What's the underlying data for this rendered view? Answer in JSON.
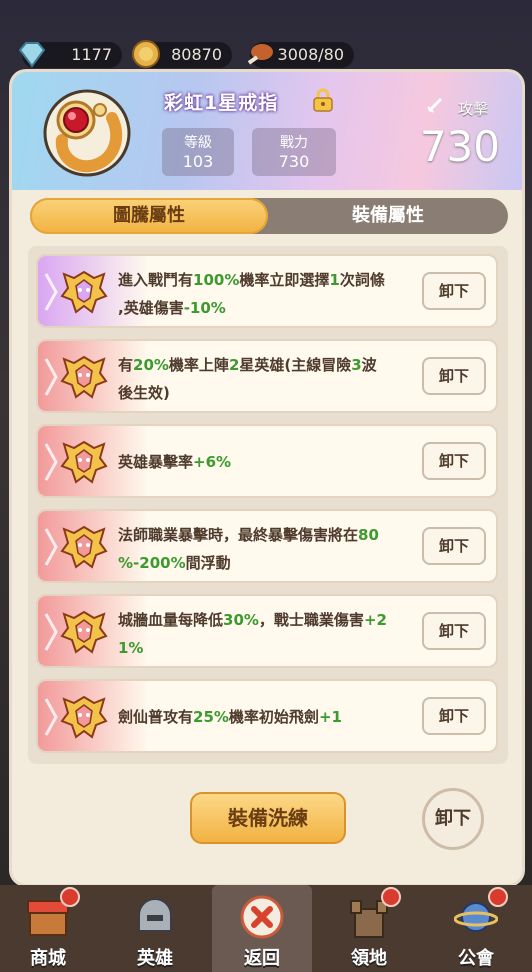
{
  "resources": [
    {
      "icon": "diamond-icon",
      "value": "1177"
    },
    {
      "icon": "coin-icon",
      "value": "80870"
    },
    {
      "icon": "meat-icon",
      "value": "3008/80"
    }
  ],
  "item": {
    "name": "彩虹1星戒指",
    "level_label": "等級",
    "level_value": "103",
    "power_label": "戰力",
    "power_value": "730",
    "attack_label": "攻擊",
    "attack_value": "730"
  },
  "tabs": [
    {
      "label": "圖騰屬性",
      "active": true
    },
    {
      "label": "裝備屬性",
      "active": false
    }
  ],
  "attributes": [
    {
      "rarity_color": "#d9a6f2",
      "segments": [
        {
          "t": "進入戰鬥有"
        },
        {
          "t": "100%",
          "h": 1
        },
        {
          "t": "機率立即選擇"
        },
        {
          "t": "1",
          "h": 1
        },
        {
          "t": "次詞條"
        },
        {
          "br": 1
        },
        {
          "t": ",英雄傷害"
        },
        {
          "t": "-10%",
          "h": 1
        }
      ],
      "button": "卸下"
    },
    {
      "rarity_color": "#f29a9a",
      "segments": [
        {
          "t": "有"
        },
        {
          "t": "20%",
          "h": 1
        },
        {
          "t": "機率上陣"
        },
        {
          "t": "2",
          "h": 1
        },
        {
          "t": "星英雄(主線冒險"
        },
        {
          "t": "3",
          "h": 1
        },
        {
          "t": "波"
        },
        {
          "br": 1
        },
        {
          "t": "後生效)"
        }
      ],
      "button": "卸下"
    },
    {
      "rarity_color": "#f29a9a",
      "segments": [
        {
          "t": "英雄暴擊率"
        },
        {
          "t": "+6%",
          "h": 1
        }
      ],
      "button": "卸下"
    },
    {
      "rarity_color": "#f29a9a",
      "segments": [
        {
          "t": "法師職業暴擊時，最終暴擊傷害將在"
        },
        {
          "t": "80",
          "h": 1
        },
        {
          "br": 1
        },
        {
          "t": "%-200%",
          "h": 1
        },
        {
          "t": "間浮動"
        }
      ],
      "button": "卸下"
    },
    {
      "rarity_color": "#f29a9a",
      "segments": [
        {
          "t": "城牆血量每降低"
        },
        {
          "t": "30%",
          "h": 1
        },
        {
          "t": "，戰士職業傷害"
        },
        {
          "t": "+2",
          "h": 1
        },
        {
          "br": 1
        },
        {
          "t": "1%",
          "h": 1
        }
      ],
      "button": "卸下"
    },
    {
      "rarity_color": "#f29a9a",
      "segments": [
        {
          "t": "劍仙普攻有"
        },
        {
          "t": "25%",
          "h": 1
        },
        {
          "t": "機率初始飛劍"
        },
        {
          "t": "+1",
          "h": 1
        }
      ],
      "button": "卸下"
    }
  ],
  "actions": {
    "refine": "裝備洗練",
    "unequip": "卸下"
  },
  "nav": [
    {
      "label": "商城",
      "icon": "shop-icon",
      "dot": true
    },
    {
      "label": "英雄",
      "icon": "helmet-icon",
      "dot": false
    },
    {
      "label": "返回",
      "icon": "close-icon",
      "dot": false
    },
    {
      "label": "領地",
      "icon": "castle-icon",
      "dot": true
    },
    {
      "label": "公會",
      "icon": "planet-icon",
      "dot": true
    }
  ]
}
